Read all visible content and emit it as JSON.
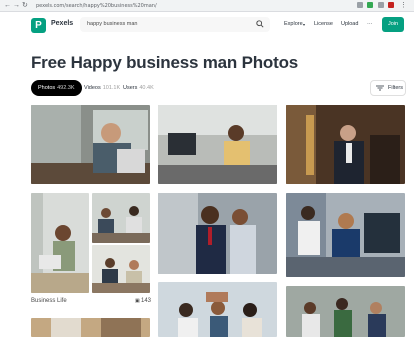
{
  "browser": {
    "url": "pexels.com/search/happy%20business%20man/"
  },
  "header": {
    "logo_letter": "P",
    "logo_text": "Pexels",
    "search_value": "happy business man",
    "nav": [
      "Explore",
      "License",
      "Upload",
      "···"
    ],
    "join_label": "Join"
  },
  "page": {
    "title": "Free Happy business man Photos"
  },
  "tabs": [
    {
      "label": "Photos",
      "count": "492.3K"
    },
    {
      "label": "Videos",
      "count": "101.1K"
    },
    {
      "label": "Users",
      "count": "40.4K"
    }
  ],
  "filters_label": "Filters",
  "collection": {
    "name": "Business Life",
    "count": "143"
  },
  "colors": {
    "brand": "#05a081",
    "text": "#2c343e"
  }
}
